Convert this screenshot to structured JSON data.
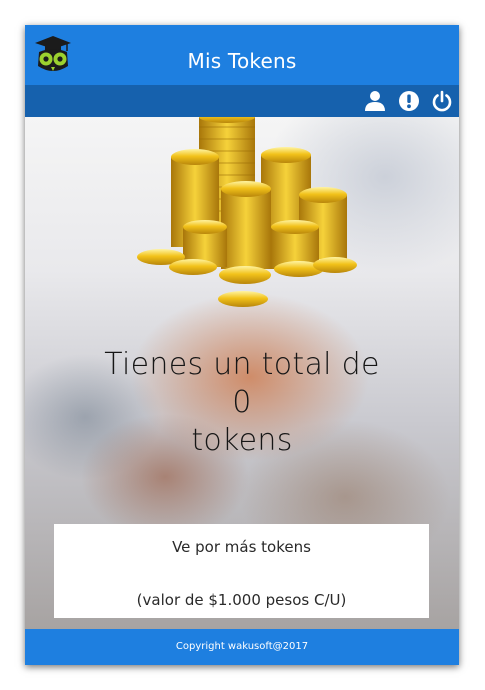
{
  "header": {
    "title": "Mis Tokens",
    "icons": [
      "owl-logo-icon",
      "user-icon",
      "info-icon",
      "power-icon"
    ]
  },
  "tokens": {
    "line1": "Tienes un total de",
    "count": "0",
    "line3": "tokens"
  },
  "purchase": {
    "label": "Ve por más tokens",
    "price_note": "(valor de $1.000 pesos C/U)"
  },
  "footer": {
    "copyright": "Copyright wakusoft@2017"
  },
  "colors": {
    "primary": "#1e7fe0",
    "primary_dark": "#1661ad",
    "coin_gold": "#f2c21a"
  }
}
